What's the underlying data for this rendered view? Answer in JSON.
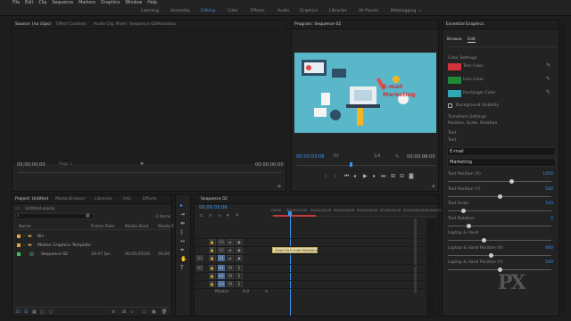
{
  "menu": [
    "File",
    "Edit",
    "Clip",
    "Sequence",
    "Markers",
    "Graphics",
    "Window",
    "Help"
  ],
  "workspaces": [
    {
      "label": "Learning",
      "active": false
    },
    {
      "label": "Assembly",
      "active": false
    },
    {
      "label": "Editing",
      "active": true
    },
    {
      "label": "Color",
      "active": false
    },
    {
      "label": "Effects",
      "active": false
    },
    {
      "label": "Audio",
      "active": false
    },
    {
      "label": "Graphics",
      "active": false
    },
    {
      "label": "Libraries",
      "active": false
    },
    {
      "label": "All Panels",
      "active": false
    },
    {
      "label": "Metalogging",
      "active": false
    }
  ],
  "source": {
    "tabs": [
      "Source: (no clips)",
      "Effect Controls",
      "Audio Clip Mixer: Sequence 02",
      "Metadata"
    ],
    "timecode_left": "00;00;00;00",
    "page": "Page 1",
    "timecode_right": "00;00;00;00"
  },
  "program": {
    "tab": "Program: Sequence 02",
    "thumb_title": "E-mail",
    "thumb_sub": "Marketing",
    "timecode": "00;00;03;06",
    "fit": "Fit",
    "res": "1/4",
    "duration": "00;00;08;00"
  },
  "project": {
    "tabs": [
      "Project: Untitled",
      "Media Browser",
      "Libraries",
      "Info",
      "Effects"
    ],
    "filename": "Untitled.prproj",
    "count": "3 items",
    "columns": [
      "Name",
      "Frame Rate",
      "Media Start",
      "Media E"
    ],
    "rows": [
      {
        "name": "Bin",
        "fps": "",
        "start": "",
        "end": "",
        "color": "#e8a33a"
      },
      {
        "name": "Motion Graphics Template",
        "fps": "",
        "start": "",
        "end": "",
        "color": "#e8a33a"
      },
      {
        "name": "Sequence 02",
        "fps": "29.97 fps",
        "start": "00;00;00;00",
        "end": "00;00",
        "color": "#3dbf5a"
      }
    ]
  },
  "timeline": {
    "tab": "Sequence 02",
    "timecode": "00;00;03;06",
    "ruler": [
      ":00;00",
      "00;00;01;00",
      "00;00;02;00",
      "00;00;03;00",
      "00;00;04;00",
      "00;00;05;00",
      "00;00;06;00",
      "00;00;07;00"
    ],
    "tracks": [
      "V3",
      "V2",
      "V1",
      "A1",
      "A2",
      "A3"
    ],
    "master": "Master",
    "master_val": "0.0",
    "clip": "Sales Ea E-mail Marketing"
  },
  "eg": {
    "title": "Essential Graphics",
    "tabs": [
      "Browse",
      "Edit"
    ],
    "section": "Color Settings",
    "colors": [
      {
        "label": "Text Color",
        "hex": "#d2323a"
      },
      {
        "label": "Icon Color",
        "hex": "#1e8a3a"
      },
      {
        "label": "Rectangle Color",
        "hex": "#2ea8b3"
      }
    ],
    "bg_label": "Background Visibility",
    "transform_label": "Transform Settings",
    "transform_sub": "Position, Scale, Rotation",
    "text_label": "Text",
    "text_label2": "Text",
    "fields": [
      "E-mail",
      "Marketing"
    ],
    "sliders": [
      {
        "label": "Text Position (X)",
        "value": "1056",
        "level": 0.62
      },
      {
        "label": "Text Position (Y)",
        "value": "540",
        "level": 0.5
      },
      {
        "label": "Text Scale",
        "value": "100",
        "level": 0.15
      },
      {
        "label": "Text Rotation",
        "value": "0",
        "level": 0.2
      },
      {
        "label": "Laptop & Hand",
        "value": "",
        "level": 0.35
      },
      {
        "label": "Laptop & Hand Position (X)",
        "value": "660",
        "level": 0.42
      },
      {
        "label": "Laptop & Hand Position (Y)",
        "value": "540",
        "level": 0.5
      }
    ]
  }
}
